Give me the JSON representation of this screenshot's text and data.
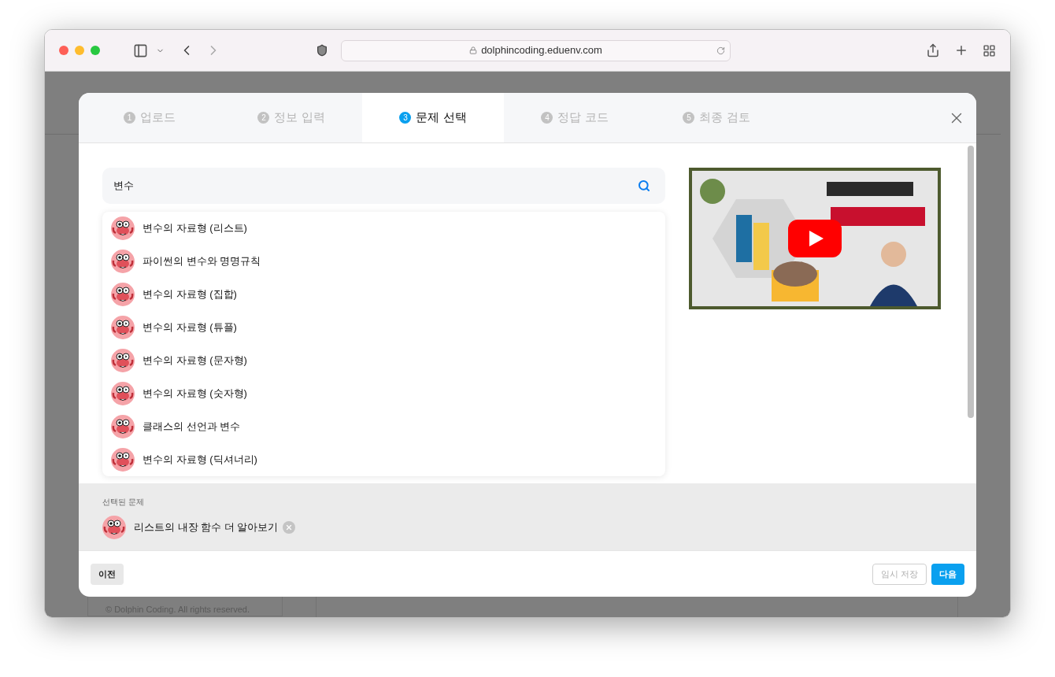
{
  "browser": {
    "url": "dolphincoding.eduenv.com"
  },
  "page": {
    "footer": "© Dolphin Coding. All rights reserved."
  },
  "modal": {
    "tabs": [
      {
        "number": "1",
        "label": "업로드",
        "selected": false
      },
      {
        "number": "2",
        "label": "정보 입력",
        "selected": false
      },
      {
        "number": "3",
        "label": "문제 선택",
        "selected": true
      },
      {
        "number": "4",
        "label": "정답 코드",
        "selected": false
      },
      {
        "number": "5",
        "label": "최종 검토",
        "selected": false
      }
    ],
    "search": {
      "value": "변수"
    },
    "results": [
      {
        "title": "변수의 자료형 (리스트)"
      },
      {
        "title": "파이썬의 변수와 명명규칙"
      },
      {
        "title": "변수의 자료형 (집합)"
      },
      {
        "title": "변수의 자료형 (튜플)"
      },
      {
        "title": "변수의 자료형 (문자형)"
      },
      {
        "title": "변수의 자료형 (숫자형)"
      },
      {
        "title": "클래스의 선언과 변수"
      },
      {
        "title": "변수의 자료형 (딕셔너리)"
      }
    ],
    "selected_section": {
      "label": "선택된 문제",
      "items": [
        {
          "title": "리스트의 내장 함수 더 알아보기"
        }
      ]
    },
    "buttons": [
      {
        "label": "이전",
        "kind": "secondary",
        "disabled": false
      },
      {
        "label": "임시 저장",
        "kind": "outline",
        "disabled": true
      },
      {
        "label": "다음",
        "kind": "primary",
        "disabled": false
      }
    ]
  }
}
